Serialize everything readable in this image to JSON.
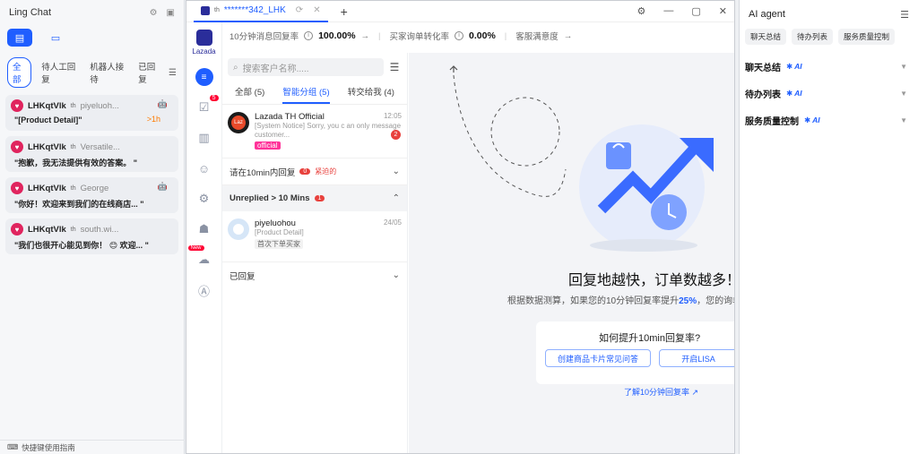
{
  "left": {
    "title": "Ling Chat",
    "filters": [
      "全部",
      "待人工回复",
      "机器人接待",
      "已回复"
    ],
    "chats": [
      {
        "name": "LHKqtVlk",
        "flag": "th",
        "customer": "piyeluoh...",
        "preview": "\"[Product Detail]\"",
        "badge": ">1h"
      },
      {
        "name": "LHKqtVlk",
        "flag": "th",
        "customer": "Versatile...",
        "preview": "\"抱歉，我无法提供有效的答案。 \"",
        "badge": ""
      },
      {
        "name": "LHKqtVlk",
        "flag": "th",
        "customer": "George",
        "preview": "\"你好！欢迎来到我们的在线商店... \"",
        "badge": ""
      },
      {
        "name": "LHKqtVlk",
        "flag": "th",
        "customer": "south.wi...",
        "preview": "\"我们也很开心能见到你！ 😊 欢迎... \"",
        "badge": ""
      }
    ],
    "footer": "快捷键使用指南"
  },
  "center": {
    "tab_flag": "th",
    "tab_title": "*******342_LHK",
    "brand": "Lazada",
    "metrics": {
      "m1_label": "10分钟消息回复率",
      "m1_value": "100.00%",
      "m2_label": "买家询单转化率",
      "m2_value": "0.00%",
      "m3_label": "客服满意度"
    },
    "rail_badges": {
      "tasks": "5",
      "new": "New"
    },
    "search_placeholder": "搜索客户名称.....",
    "segments": [
      "全部 (5)",
      "智能分组 (5)",
      "转交给我 (4)"
    ],
    "conversations": [
      {
        "name": "Lazada TH Official",
        "msg": "[System Notice] Sorry, you c an only message customer...",
        "tag": "official",
        "time": "12:05",
        "unread": "2",
        "avatar": "Laz"
      },
      {
        "name": "piyeluohou",
        "msg": "[Product Detail]",
        "tag": "首次下单买家",
        "time": "24/05",
        "unread": "",
        "avatar": ""
      }
    ],
    "groups": {
      "g1_label": "请在10min内回复",
      "g1_count": "0",
      "g1_urgent": "紧迫的",
      "g2_label": "Unreplied > 10 Mins",
      "g2_count": "1",
      "g3_label": "已回复"
    },
    "promo": {
      "title": "回复地越快，订单数越多！",
      "sub_pre": "根据数据测算，如果您的10分钟回复率提升",
      "sub_pct": "25%",
      "sub_post": "，您的询单",
      "card_title": "如何提升10min回复率?",
      "btn1": "创建商品卡片常见问答",
      "btn2": "开启LISA",
      "learn": "了解10分钟回复率"
    }
  },
  "right": {
    "title": "AI agent",
    "tabs": [
      "聊天总结",
      "待办列表",
      "服务质量控制"
    ],
    "sections": [
      {
        "label": "聊天总结",
        "ai": "AI"
      },
      {
        "label": "待办列表",
        "ai": "AI"
      },
      {
        "label": "服务质量控制",
        "ai": "AI"
      }
    ]
  },
  "colors": {
    "accent": "#1f5eff",
    "danger": "#e8413d",
    "lazada": "#2a2d9a"
  }
}
